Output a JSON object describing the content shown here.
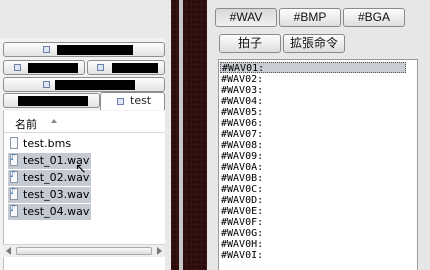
{
  "left": {
    "tabs": [
      {
        "name": "[redacted]"
      },
      {
        "name": "[redacted]"
      },
      {
        "name": "[redacted]"
      },
      {
        "name": "[redacted]"
      },
      {
        "name": "[redacted]"
      }
    ],
    "active_tab": "test",
    "list_header": "名前",
    "files": [
      {
        "name": "test.bms",
        "type": "bms",
        "selected": false
      },
      {
        "name": "test_01.wav",
        "type": "wav",
        "selected": true
      },
      {
        "name": "test_02.wav",
        "type": "wav",
        "selected": true
      },
      {
        "name": "test_03.wav",
        "type": "wav",
        "selected": true
      },
      {
        "name": "test_04.wav",
        "type": "wav",
        "selected": true
      }
    ]
  },
  "right": {
    "buttons": {
      "wav": "#WAV",
      "bmp": "#BMP",
      "bga": "#BGA",
      "beat": "拍子",
      "ext": "拡張命令"
    },
    "active_button": "#WAV",
    "wav_rows": [
      "#WAV01:",
      "#WAV02:",
      "#WAV03:",
      "#WAV04:",
      "#WAV05:",
      "#WAV06:",
      "#WAV07:",
      "#WAV08:",
      "#WAV09:",
      "#WAV0A:",
      "#WAV0B:",
      "#WAV0C:",
      "#WAV0D:",
      "#WAV0E:",
      "#WAV0F:",
      "#WAV0G:",
      "#WAV0H:",
      "#WAV0I:"
    ],
    "selected_row": 0
  },
  "colors": {
    "divider": "#2a0c0c",
    "selection": "#c4c9d2"
  }
}
